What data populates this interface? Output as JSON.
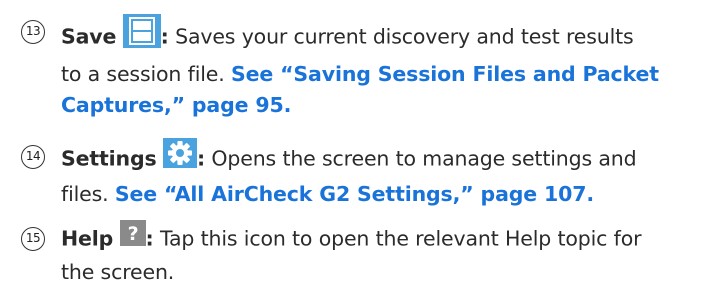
{
  "items": [
    {
      "number": "13",
      "title": "Save",
      "colon": ":",
      "description": "Saves your current discovery and test results to a session file.",
      "desc_line1": "Saves your current discovery and test results",
      "desc_line2": "to a session file.",
      "link_part1": "See “Saving Session Files and Packet",
      "link_part2": "Captures,” page 95.",
      "icon": "save-icon",
      "icon_color": "#4aa3df"
    },
    {
      "number": "14",
      "title": "Settings",
      "colon": ":",
      "desc_line1": "Opens the screen to manage settings and",
      "desc_line2": "files.",
      "link": "See “All AirCheck G2 Settings,” page 107.",
      "icon": "gear-icon",
      "icon_color": "#4aa3df"
    },
    {
      "number": "15",
      "title": "Help",
      "colon": ":",
      "desc_line1": "Tap this icon to open the relevant Help topic for",
      "desc_line2": "the screen.",
      "icon": "help-icon",
      "icon_color": "#8a8a8a"
    }
  ],
  "link_color": "#1a73d9"
}
